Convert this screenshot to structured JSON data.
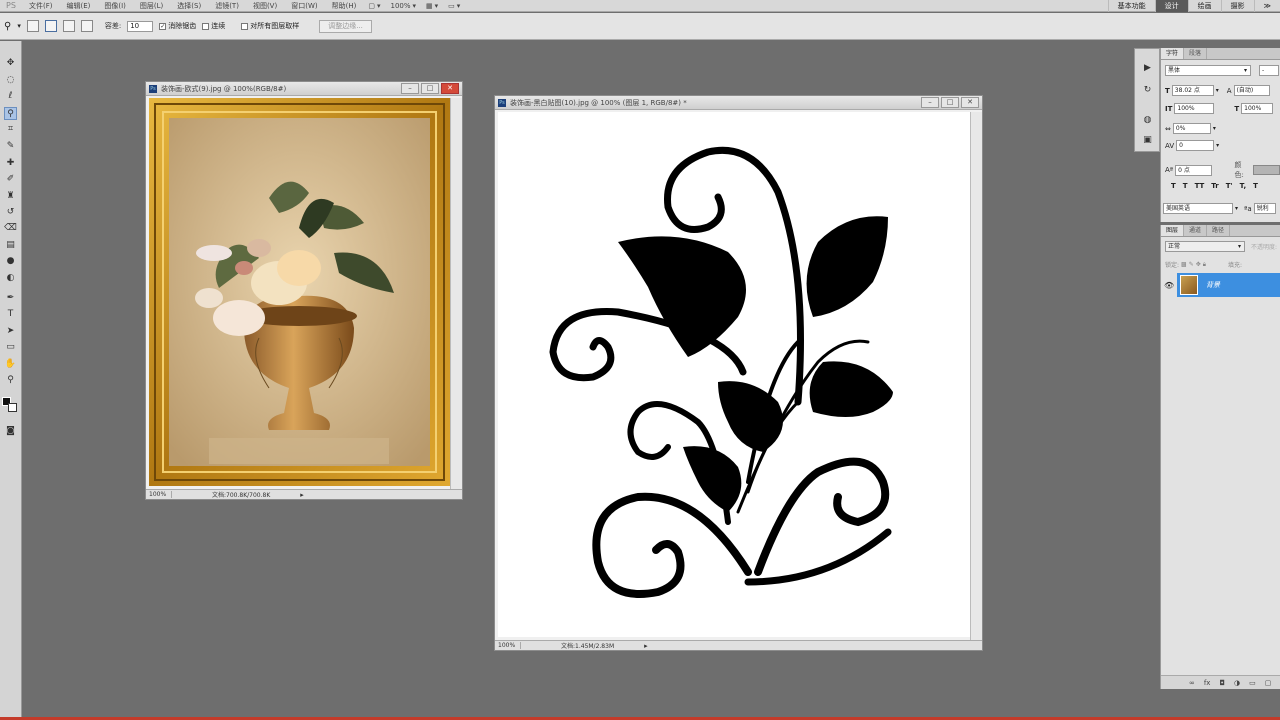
{
  "menubar": {
    "logo": "PS",
    "items": [
      "文件(F)",
      "编辑(E)",
      "图像(I)",
      "图层(L)",
      "选择(S)",
      "滤镜(T)",
      "视图(V)",
      "窗口(W)",
      "帮助(H)"
    ],
    "zoom": "100%",
    "workspaces": [
      "基本功能",
      "设计",
      "绘画",
      "摄影"
    ],
    "overflow": "≫"
  },
  "options": {
    "tolerance_label": "容差:",
    "tolerance_value": "10",
    "antialias_label": "消除锯齿",
    "contiguous_label": "连续",
    "sample_all_label": "对所有图层取样",
    "refine_button": "调整边缘..."
  },
  "doc1": {
    "title": "装饰画-欧式(9).jpg @ 100%(RGB/8#)",
    "zoom": "100%",
    "status": "文档:700.8K/700.8K"
  },
  "doc2": {
    "title": "装饰画-黑白贴图(10).jpg @ 100% (图层 1, RGB/8#) *",
    "zoom": "100%",
    "status": "文档:1.45M/2.83M"
  },
  "character": {
    "tabs": [
      "字符",
      "段落"
    ],
    "font_family": "黑体",
    "font_style": "-",
    "font_size": "38.02 点",
    "leading": "(自动)",
    "vscale": "100%",
    "hscale": "100%",
    "tracking": "0%",
    "kerning": "0",
    "baseline": "0 点",
    "color_label": "颜色:",
    "language": "美国英语",
    "aa_mode": "锐利",
    "styles": [
      "T",
      "T",
      "TT",
      "Tr",
      "T'",
      "T,",
      "T"
    ]
  },
  "layers": {
    "tabs": [
      "图层",
      "通道",
      "路径"
    ],
    "blend_mode": "正常",
    "opacity_label": "不透明度:",
    "lock_label": "锁定:",
    "fill_label": "填充:",
    "layer_name": "背景"
  },
  "colors": {
    "accent": "#3d8fe0",
    "menubar": "#d8d8d8",
    "workspace": "#6e6e6e",
    "frame_gold": "#c8921a"
  }
}
